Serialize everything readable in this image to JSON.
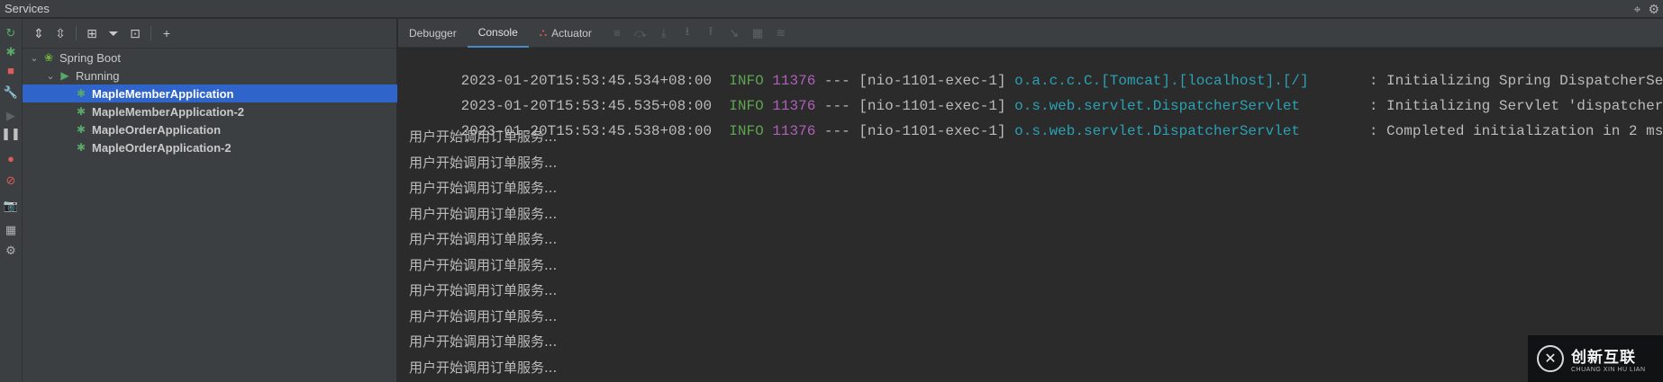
{
  "window": {
    "title": "Services",
    "right_icons": [
      "crosshair-icon",
      "gear-icon"
    ]
  },
  "left_toolbar": {
    "buttons": [
      {
        "name": "rerun-icon",
        "glyph": "↻",
        "color": "#59a869"
      },
      {
        "name": "debug-rerun-icon",
        "glyph": "✱",
        "color": "#59a869"
      },
      {
        "name": "stop-icon",
        "glyph": "■",
        "color": "#db5c5c"
      },
      {
        "name": "wrench-icon",
        "glyph": "🔧",
        "color": "#b0b0b0"
      },
      {
        "name": "resume-icon",
        "glyph": "▶",
        "color": "#5e6166"
      },
      {
        "name": "pause-icon",
        "glyph": "❚❚",
        "color": "#c0c0c0"
      },
      {
        "name": "view-breakpoints-icon",
        "glyph": "●",
        "color": "#db5c5c"
      },
      {
        "name": "mute-breakpoints-icon",
        "glyph": "⊘",
        "color": "#db5c5c"
      },
      {
        "name": "camera-icon",
        "glyph": "📷",
        "color": "#b0b0b0"
      },
      {
        "name": "layout-icon",
        "glyph": "▦",
        "color": "#b0b0b0"
      },
      {
        "name": "settings-icon",
        "glyph": "⚙",
        "color": "#b0b0b0"
      }
    ]
  },
  "tree_toolbar": {
    "buttons": [
      "expand-all-icon",
      "collapse-all-icon",
      "group-icon",
      "filter-icon",
      "new-service-icon",
      "add-icon"
    ]
  },
  "tree": {
    "nodes": [
      {
        "label": "Spring Boot",
        "level": 0,
        "expanded": true,
        "icon": "spring-boot-icon",
        "selected": false,
        "bold": false
      },
      {
        "label": "Running",
        "level": 1,
        "expanded": true,
        "icon": "run-icon",
        "selected": false,
        "bold": false
      },
      {
        "label": "MapleMemberApplication",
        "level": 2,
        "icon": "bug-icon",
        "selected": true,
        "bold": true
      },
      {
        "label": "MapleMemberApplication-2",
        "level": 2,
        "icon": "bug-icon",
        "selected": false,
        "bold": true
      },
      {
        "label": "MapleOrderApplication",
        "level": 2,
        "icon": "bug-icon",
        "selected": false,
        "bold": true
      },
      {
        "label": "MapleOrderApplication-2",
        "level": 2,
        "icon": "bug-icon",
        "selected": false,
        "bold": true
      }
    ]
  },
  "tabs": [
    {
      "label": "Debugger",
      "active": false
    },
    {
      "label": "Console",
      "active": true
    },
    {
      "label": "Actuator",
      "active": false
    }
  ],
  "console_tools": [
    "menu-icon",
    "restore-layout-icon",
    "step-over-icon",
    "step-into-icon",
    "step-out-icon",
    "run-to-cursor-icon",
    "evaluate-icon",
    "trace-icon"
  ],
  "log_lines": [
    {
      "ts": "2023-01-20T15:53:45.534+08:00",
      "level": "INFO",
      "pid": "11376",
      "dash": "---",
      "thread": "[nio-1101-exec-1]",
      "logger": "o.a.c.c.C.[Tomcat].[localhost].[/]",
      "msg": ": Initializing Spring DispatcherSe"
    },
    {
      "ts": "2023-01-20T15:53:45.535+08:00",
      "level": "INFO",
      "pid": "11376",
      "dash": "---",
      "thread": "[nio-1101-exec-1]",
      "logger": "o.s.web.servlet.DispatcherServlet",
      "msg": ": Initializing Servlet 'dispatcher"
    },
    {
      "ts": "2023-01-20T15:53:45.538+08:00",
      "level": "INFO",
      "pid": "11376",
      "dash": "---",
      "thread": "[nio-1101-exec-1]",
      "logger": "o.s.web.servlet.DispatcherServlet",
      "msg": ": Completed initialization in 2 ms"
    }
  ],
  "output_lines": [
    "用户开始调用订单服务...",
    "用户开始调用订单服务...",
    "用户开始调用订单服务...",
    "用户开始调用订单服务...",
    "用户开始调用订单服务...",
    "用户开始调用订单服务...",
    "用户开始调用订单服务...",
    "用户开始调用订单服务...",
    "用户开始调用订单服务...",
    "用户开始调用订单服务..."
  ],
  "watermark": {
    "main": "创新互联",
    "sub": "CHUANG XIN HU LIAN"
  },
  "colors": {
    "selection": "#2f65ca",
    "info": "#5fa352",
    "pid": "#b15fb8",
    "logger": "#2aa1b3",
    "tab_underline": "#4a88c7"
  }
}
